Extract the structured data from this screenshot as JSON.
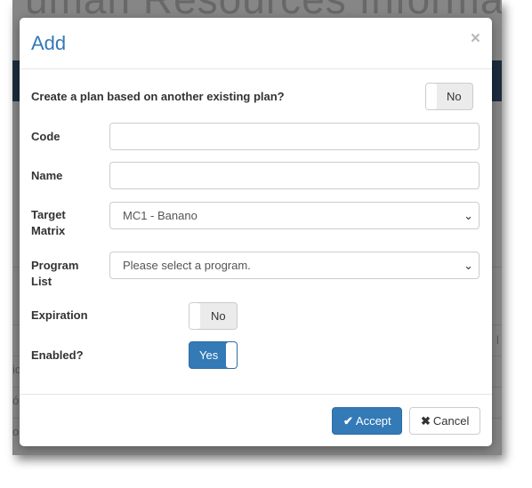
{
  "background": {
    "title_fragment": "uman Resources Information",
    "side_chars": [
      "ic",
      "ó",
      "o",
      "l"
    ]
  },
  "modal": {
    "title": "Add",
    "close_symbol": "×",
    "fields": {
      "base_plan": {
        "label": "Create a plan based on another existing plan?",
        "toggle": "No"
      },
      "code": {
        "label": "Code",
        "value": "",
        "placeholder": ""
      },
      "name": {
        "label": "Name",
        "value": "",
        "placeholder": ""
      },
      "target_matrix": {
        "label_line1": "Target",
        "label_line2": "Matrix",
        "selected": "MC1 - Banano"
      },
      "program_list": {
        "label_line1": "Program",
        "label_line2": "List",
        "selected": "Please select a program."
      },
      "expiration": {
        "label": "Expiration",
        "toggle": "No"
      },
      "enabled": {
        "label": "Enabled?",
        "toggle": "Yes"
      }
    },
    "footer": {
      "accept_label": "Accept",
      "cancel_label": "Cancel",
      "accept_icon": "check-icon",
      "cancel_icon": "times-icon"
    }
  },
  "colors": {
    "accent": "#337ab7",
    "title": "#3479b7",
    "navbar": "#35506d"
  }
}
